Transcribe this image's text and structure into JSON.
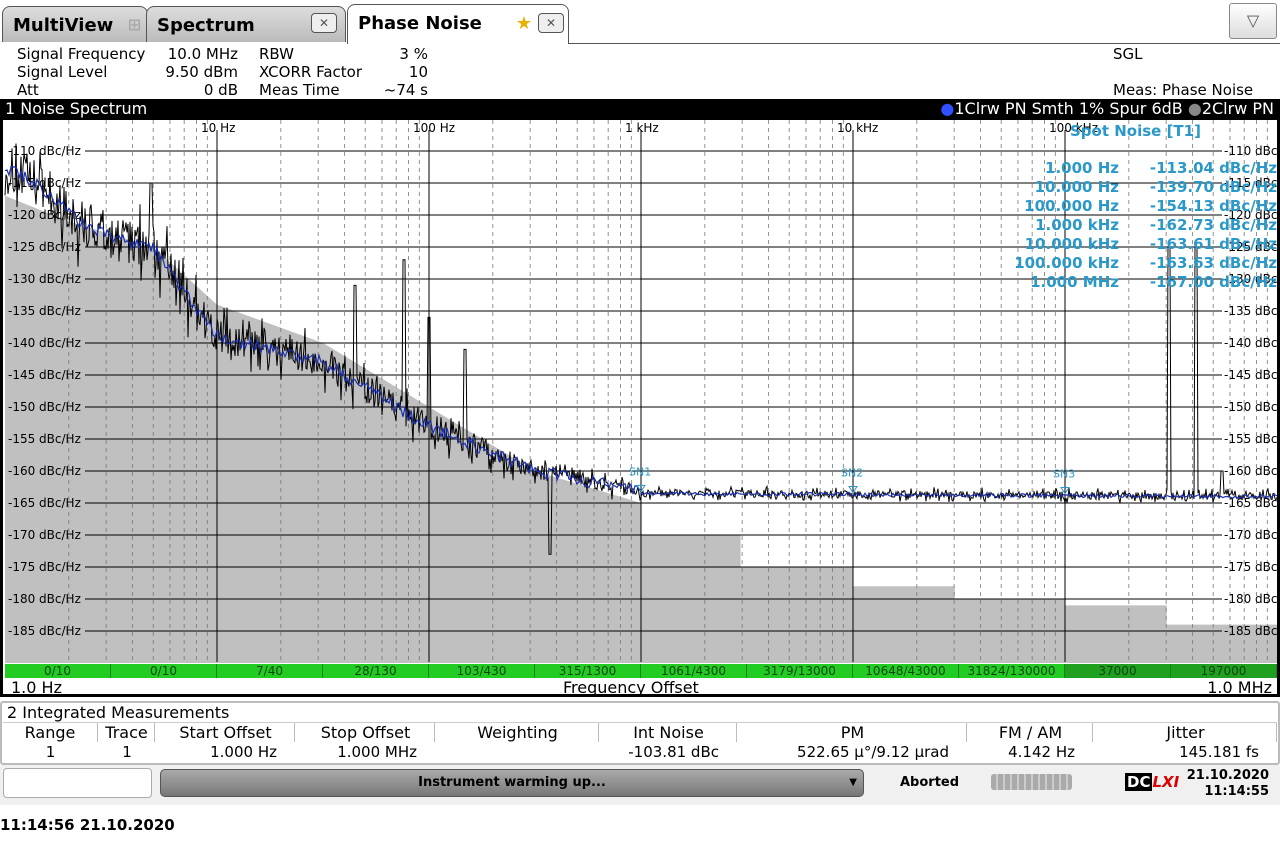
{
  "tabs": [
    {
      "label": "MultiView",
      "icon": "grid-icon"
    },
    {
      "label": "Spectrum",
      "icon": "close-icon"
    },
    {
      "label": "Phase Noise",
      "icon": "close-icon",
      "active": true
    }
  ],
  "dropdown_icon": "▽",
  "params": {
    "left": [
      {
        "label": "Signal Frequency",
        "value": "10.0 MHz"
      },
      {
        "label": "Signal Level",
        "value": "9.50 dBm"
      },
      {
        "label": "Att",
        "value": "0 dB"
      }
    ],
    "mid": [
      {
        "label": "RBW",
        "value": "3 %"
      },
      {
        "label": "XCORR Factor",
        "value": "10"
      },
      {
        "label": "Meas Time",
        "value": "~74 s"
      }
    ],
    "mode": "SGL",
    "meas": "Meas: Phase Noise"
  },
  "window1": {
    "title": "1 Noise Spectrum",
    "trace1": "1Clrw PN Smth 1% Spur 6dB",
    "trace2": "2Clrw PN"
  },
  "spot_noise": {
    "title": "Spot Noise [T1]",
    "rows": [
      {
        "f": "1.000 Hz",
        "v": "-113.04 dBc/Hz"
      },
      {
        "f": "10.000 Hz",
        "v": "-139.70 dBc/Hz"
      },
      {
        "f": "100.000 Hz",
        "v": "-154.13 dBc/Hz"
      },
      {
        "f": "1.000 kHz",
        "v": "-162.73 dBc/Hz"
      },
      {
        "f": "10.000 kHz",
        "v": "-163.61 dBc/Hz"
      },
      {
        "f": "100.000 kHz",
        "v": "-163.63 dBc/Hz"
      },
      {
        "f": "1.000 MHz",
        "v": "-167.00 dBc/Hz"
      }
    ]
  },
  "markers": [
    "SN1",
    "SN2",
    "SN3"
  ],
  "xcorr_bar": [
    "0/10",
    "0/10",
    "7/40",
    "28/130",
    "103/430",
    "315/1300",
    "1061/4300",
    "3179/13000",
    "10648/43000",
    "31824/130000",
    "37000",
    "197000"
  ],
  "x_axis": {
    "start": "1.0 Hz",
    "label": "Frequency Offset",
    "stop": "1.0 MHz"
  },
  "chart_data": {
    "type": "line",
    "xscale": "log",
    "xlim_hz": [
      1,
      1000000
    ],
    "ylim": [
      -190,
      -105
    ],
    "x_ticks": [
      "10 Hz",
      "100 Hz",
      "1 kHz",
      "10 kHz",
      "100 kHz"
    ],
    "y_ticks": [
      "-110 dBc/Hz",
      "-115 dBc/Hz",
      "-120 dBc/Hz",
      "-125 dBc/Hz",
      "-130 dBc/Hz",
      "-135 dBc/Hz",
      "-140 dBc/Hz",
      "-145 dBc/Hz",
      "-150 dBc/Hz",
      "-155 dBc/Hz",
      "-160 dBc/Hz",
      "-165 dBc/Hz",
      "-170 dBc/Hz",
      "-175 dBc/Hz",
      "-180 dBc/Hz",
      "-185 dBc/Hz"
    ],
    "smoothed_trace": [
      [
        0,
        -113
      ],
      [
        0.1,
        -114
      ],
      [
        0.35,
        -121
      ],
      [
        0.55,
        -124
      ],
      [
        0.7,
        -125
      ],
      [
        0.8,
        -130
      ],
      [
        1.0,
        -139
      ],
      [
        1.5,
        -143
      ],
      [
        2.0,
        -153
      ],
      [
        2.5,
        -160
      ],
      [
        2.9,
        -162.5
      ],
      [
        3.0,
        -163.5
      ],
      [
        6.0,
        -164
      ],
      [
        6.2,
        -164.5
      ],
      [
        6.5,
        -167
      ]
    ],
    "spurs": [
      [
        0.69,
        -115
      ],
      [
        1.88,
        -127
      ],
      [
        1.65,
        -131
      ],
      [
        2.0,
        -136
      ],
      [
        2.17,
        -141
      ],
      [
        2.57,
        -173
      ],
      [
        5.49,
        -125
      ],
      [
        5.62,
        -125
      ],
      [
        5.74,
        -160
      ]
    ],
    "xcorr_limit": [
      [
        0,
        -117
      ],
      [
        0.3,
        -121
      ],
      [
        0.7,
        -125
      ],
      [
        1.0,
        -134
      ],
      [
        1.5,
        -140
      ],
      [
        2.0,
        -150
      ],
      [
        2.5,
        -160
      ],
      [
        3.0,
        -165
      ],
      [
        3.0,
        -170
      ],
      [
        3.47,
        -170
      ],
      [
        3.47,
        -175
      ],
      [
        4.0,
        -175
      ],
      [
        4.0,
        -178
      ],
      [
        4.48,
        -178
      ],
      [
        4.48,
        -180
      ],
      [
        5.0,
        -180
      ],
      [
        5.0,
        -181
      ],
      [
        5.48,
        -181
      ],
      [
        5.48,
        -184
      ],
      [
        6.0,
        -184
      ]
    ],
    "marker_x_log": [
      3,
      4,
      5
    ]
  },
  "integrated": {
    "title": "2 Integrated Measurements",
    "headers": [
      "Range",
      "Trace",
      "Start Offset",
      "Stop Offset",
      "Weighting",
      "Int Noise",
      "PM",
      "FM / AM",
      "Jitter"
    ],
    "row": [
      "1",
      "1",
      "1.000 Hz",
      "1.000 MHz",
      "",
      "-103.81 dBc",
      "522.65 µ°/9.12 µrad",
      "4.142 Hz",
      "145.181 fs"
    ]
  },
  "status": {
    "message": "Instrument warming up...",
    "state": "Aborted",
    "date": "21.10.2020",
    "time": "11:14:55",
    "logo": "DC LXI"
  },
  "footer": "11:14:56  21.10.2020",
  "colors": {
    "trace": "#000000",
    "smooth": "#1a2fb0",
    "limit": "#c0c0c0",
    "marker": "#2a98c8",
    "green": "#22cc22"
  }
}
